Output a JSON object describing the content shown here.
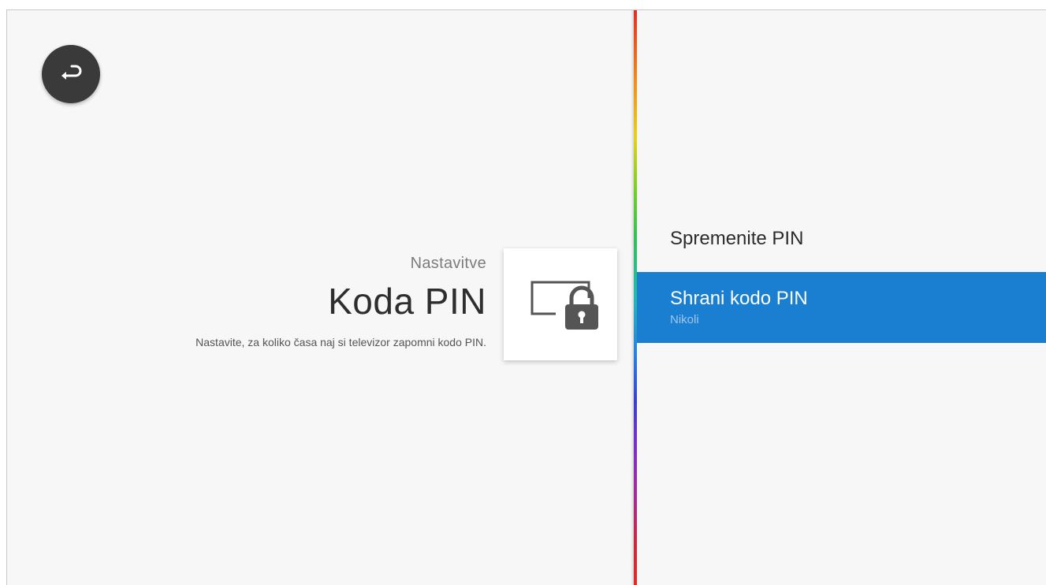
{
  "header": {
    "breadcrumb": "Nastavitve",
    "title": "Koda PIN",
    "description": "Nastavite, za koliko časa naj si televizor zapomni kodo PIN."
  },
  "back_button": {
    "icon": "back-arrow-icon"
  },
  "card": {
    "icon": "tv-lock-icon"
  },
  "menu": {
    "items": [
      {
        "label": "Spremenite PIN",
        "sublabel": "",
        "selected": false
      },
      {
        "label": "Shrani kodo PIN",
        "sublabel": "Nikoli",
        "selected": true
      }
    ]
  },
  "colors": {
    "selected_bg": "#1a7fd0",
    "background": "#f7f7f7",
    "back_button_bg": "#3a3a3a"
  }
}
